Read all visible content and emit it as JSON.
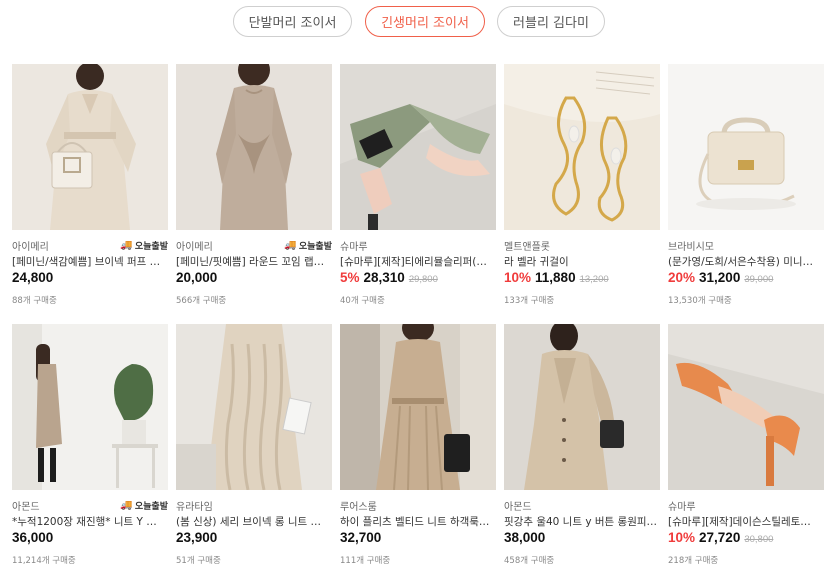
{
  "tabs": [
    {
      "label": "단발머리 조이서",
      "active": false
    },
    {
      "label": "긴생머리 조이서",
      "active": true
    },
    {
      "label": "러블리 김다미",
      "active": false
    }
  ],
  "badge_label": "오늘출발",
  "colors": {
    "accent": "#f0604a",
    "discount": "#f03c3c"
  },
  "products": [
    {
      "seller": "아이메리",
      "badge": true,
      "title": "[페미닌/색감예쁨] 브이넥 퍼프 …",
      "discount": "",
      "price": "24,800",
      "original": "",
      "sold": "88개 구매중",
      "image": "beige-belted-dress-with-bag"
    },
    {
      "seller": "아이메리",
      "badge": true,
      "title": "[페미닌/핏예쁨] 라운드 꼬임 랩…",
      "discount": "",
      "price": "20,000",
      "original": "",
      "sold": "566개 구매중",
      "image": "taupe-twist-knit-dress"
    },
    {
      "seller": "슈마루",
      "badge": false,
      "title": "[슈마루][제작]티에리뮬슬리퍼(…",
      "discount": "5%",
      "price": "28,310",
      "original": "29,800",
      "sold": "40개 구매중",
      "image": "sage-pointed-mule"
    },
    {
      "seller": "멜트앤플롯",
      "badge": false,
      "title": "라 벨라 귀걸이",
      "discount": "10%",
      "price": "11,880",
      "original": "13,200",
      "sold": "133개 구매중",
      "image": "gold-drop-earrings"
    },
    {
      "seller": "브라비시모",
      "badge": false,
      "title": "(문가영/도희/서은수착용) 미니…",
      "discount": "20%",
      "price": "31,200",
      "original": "39,000",
      "sold": "13,530개 구매중",
      "image": "cream-mini-bag"
    },
    {
      "seller": "아몬드",
      "badge": true,
      "title": "*누적1200장 재진행* 니트 Y …",
      "discount": "",
      "price": "36,000",
      "original": "",
      "sold": "11,214개 구매중",
      "image": "long-knit-dress-room"
    },
    {
      "seller": "유라타임",
      "badge": false,
      "title": "(봄 신상) 세리 브이넥 롱 니트 …",
      "discount": "",
      "price": "23,900",
      "original": "",
      "sold": "51개 구매중",
      "image": "cable-knit-long-dress"
    },
    {
      "seller": "루어스룸",
      "badge": false,
      "title": "하이 플리츠 벨티드 니트 하객룩…",
      "discount": "",
      "price": "32,700",
      "original": "",
      "sold": "111개 구매중",
      "image": "pleated-knit-dress"
    },
    {
      "seller": "아몬드",
      "badge": false,
      "title": "핏강추 울40 니트 y 버튼 롱원피…",
      "discount": "",
      "price": "38,000",
      "original": "",
      "sold": "458개 구매중",
      "image": "button-knit-dress"
    },
    {
      "seller": "슈마루",
      "badge": false,
      "title": "[슈마루][제작]데이슨스틸레토…",
      "discount": "10%",
      "price": "27,720",
      "original": "30,800",
      "sold": "218개 구매중",
      "image": "orange-slingback-heel"
    }
  ]
}
